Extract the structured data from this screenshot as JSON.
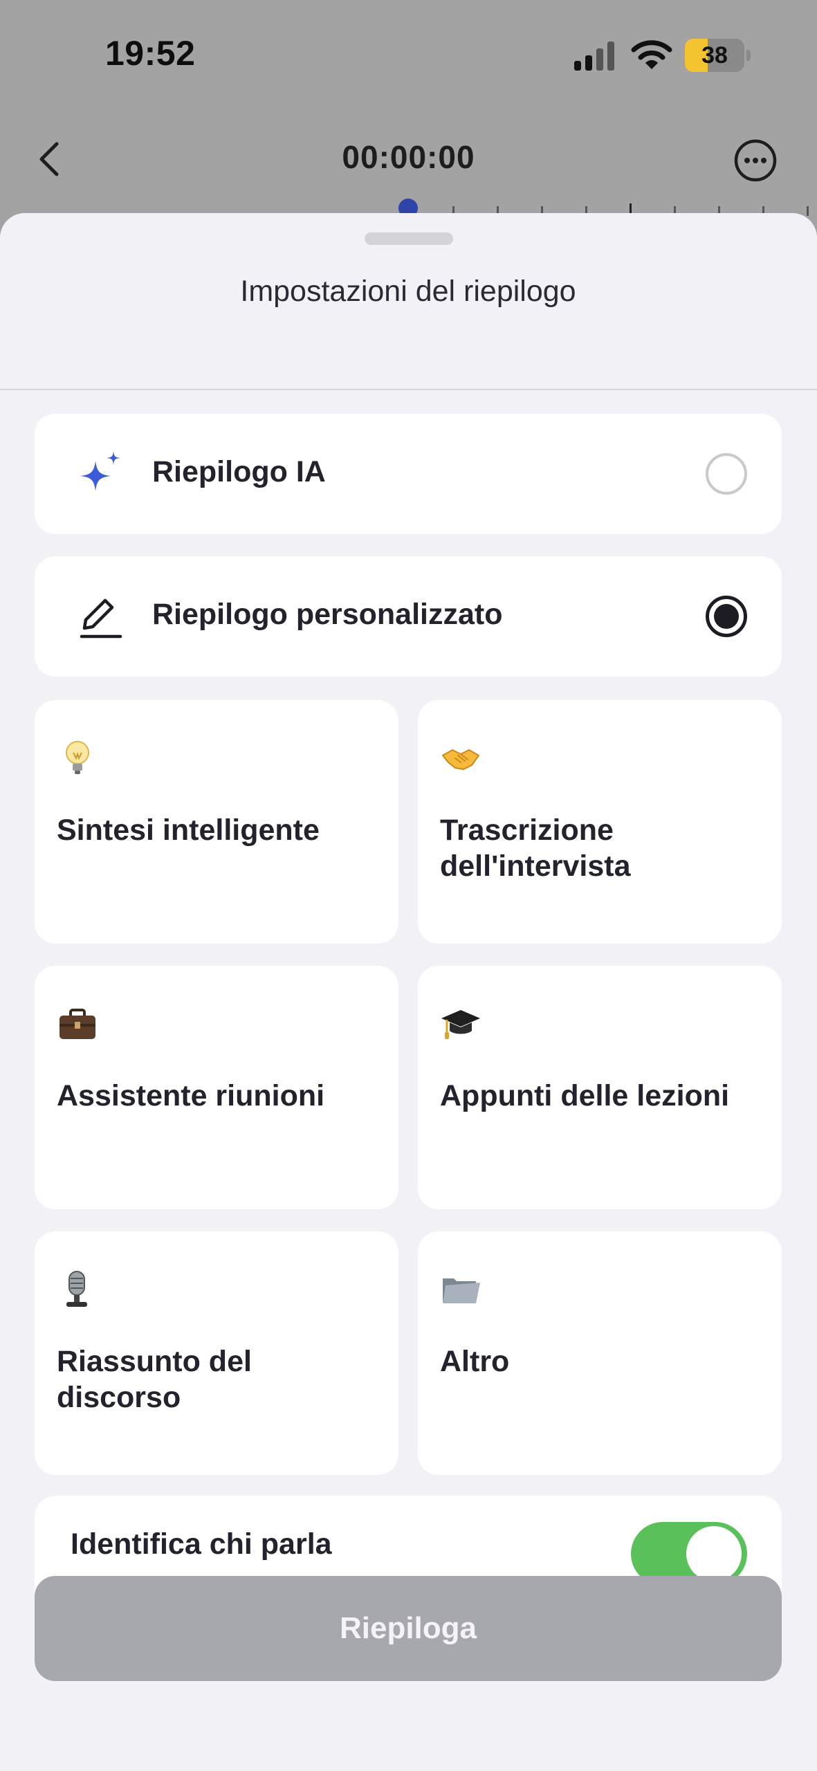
{
  "status_bar": {
    "time": "19:52",
    "battery_level": "38",
    "battery_fraction": 0.38,
    "colors": {
      "battery": "#f4c430"
    }
  },
  "header": {
    "timer": "00:00:00",
    "back_icon": "chevron-left-icon",
    "more_icon": "ellipsis-circle-icon"
  },
  "sheet": {
    "title": "Impostazioni del riepilogo",
    "options": [
      {
        "label": "Riepilogo IA",
        "icon": "sparkle-icon",
        "selected": false
      },
      {
        "label": "Riepilogo personalizzato",
        "icon": "pencil-icon",
        "selected": true
      }
    ],
    "templates": [
      {
        "label": "Sintesi intelligente",
        "icon": "light-bulb-icon"
      },
      {
        "label": "Trascrizione dell'intervista",
        "icon": "handshake-icon"
      },
      {
        "label": "Assistente riunioni",
        "icon": "briefcase-icon"
      },
      {
        "label": "Appunti delle lezioni",
        "icon": "graduation-cap-icon"
      },
      {
        "label": "Riassunto del discorso",
        "icon": "microphone-icon"
      },
      {
        "label": "Altro",
        "icon": "folder-icon"
      }
    ],
    "speaker_toggle": {
      "label": "Identifica chi parla",
      "on": true
    },
    "summarize_button": "Riepiloga",
    "colors": {
      "accent": "#3d5bd9",
      "toggle_on": "#5ac05a",
      "button_disabled": "#a7a8ad"
    }
  }
}
